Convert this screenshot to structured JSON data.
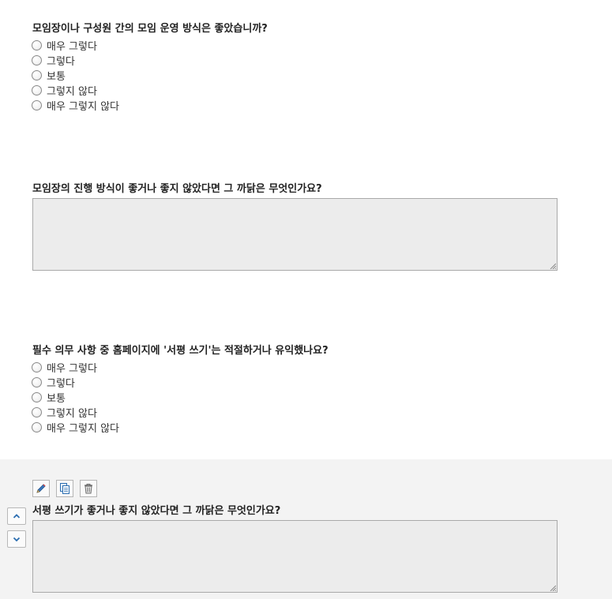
{
  "questions": [
    {
      "title": "모임장이나 구성원 간의 모임 운영 방식은 좋았습니까?",
      "options": [
        "매우 그렇다",
        "그렇다",
        "보통",
        "그렇지 않다",
        "매우 그렇지 않다"
      ]
    },
    {
      "title": "모임장의 진행 방식이 좋거나 좋지 않았다면 그 까닭은 무엇인가요?",
      "value": ""
    },
    {
      "title": "필수 의무 사항 중 홈페이지에 '서평 쓰기'는 적절하거나 유익했나요?",
      "options": [
        "매우 그렇다",
        "그렇다",
        "보통",
        "그렇지 않다",
        "매우 그렇지 않다"
      ]
    },
    {
      "title": "서평 쓰기가 좋거나 좋지 않았다면 그 까닭은 무엇인가요?",
      "value": ""
    }
  ],
  "toolbar": {
    "edit_icon": "pencil-icon",
    "copy_icon": "copy-icon",
    "delete_icon": "trash-icon",
    "move_up_icon": "chevron-up-icon",
    "move_down_icon": "chevron-down-icon"
  },
  "colors": {
    "selected_panel_bg": "#f3f3f3",
    "textarea_bg": "#ececec",
    "icon_blue": "#2a6db0"
  }
}
